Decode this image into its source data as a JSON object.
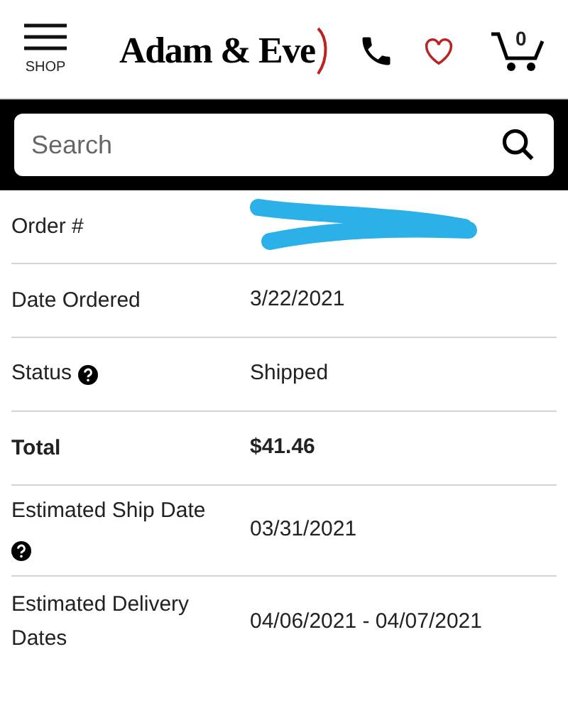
{
  "header": {
    "menu_label": "SHOP",
    "logo": "Adam & Eve",
    "cart_count": "0"
  },
  "search": {
    "placeholder": "Search"
  },
  "rows": [
    {
      "label": "Order #",
      "redacted": true,
      "bold": false,
      "help": false
    },
    {
      "label": "Date Ordered",
      "value": "3/22/2021",
      "redacted": false,
      "bold": false,
      "help": false
    },
    {
      "label": "Status",
      "value": "Shipped",
      "redacted": false,
      "bold": false,
      "help": true
    },
    {
      "label": "Total",
      "value": "$41.46",
      "redacted": false,
      "bold": true,
      "help": false
    },
    {
      "label": "Estimated Ship Date",
      "value": "03/31/2021",
      "redacted": false,
      "bold": false,
      "help": true
    },
    {
      "label": "Estimated Delivery Dates",
      "value": "04/06/2021 - 04/07/2021",
      "redacted": false,
      "bold": false,
      "help": false
    }
  ]
}
